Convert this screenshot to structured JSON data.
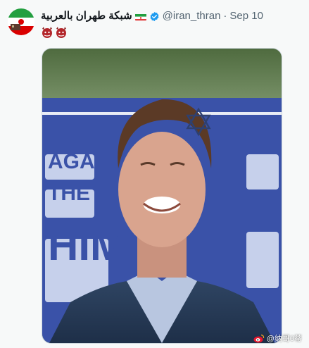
{
  "tweet": {
    "display_name": "شبكة طهران بالعربية",
    "handle": "@iran_thran",
    "separator": "·",
    "date": "Sep 10",
    "media_sign_text": "AGA\nTHE\nHIM"
  },
  "watermark": {
    "text": "@纳哥0蒂"
  },
  "colors": {
    "accent_blue": "#1d9bf0",
    "secondary_text": "#536471",
    "background": "#f7f9f9"
  }
}
